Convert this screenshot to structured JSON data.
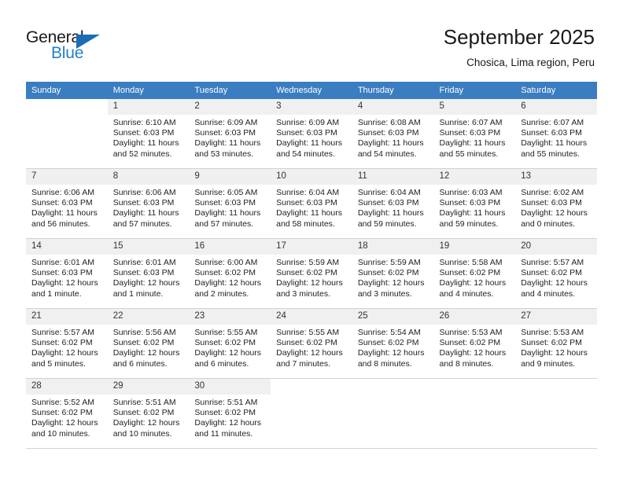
{
  "brand": {
    "name_part1": "General",
    "name_part2": "Blue",
    "triangle_color": "#1b6cb5",
    "blue_color": "#2580c8"
  },
  "header": {
    "title": "September 2025",
    "subtitle": "Chosica, Lima region, Peru"
  },
  "theme": {
    "header_row_bg": "#3a7dc0",
    "daynum_bg": "#f0f0f0",
    "grid_line": "#d2d2d2"
  },
  "weekdays": [
    "Sunday",
    "Monday",
    "Tuesday",
    "Wednesday",
    "Thursday",
    "Friday",
    "Saturday"
  ],
  "weeks": [
    [
      {
        "day": "",
        "blank": true,
        "sunrise": "",
        "sunset": "",
        "daylight1": "",
        "daylight2": ""
      },
      {
        "day": "1",
        "sunrise": "Sunrise: 6:10 AM",
        "sunset": "Sunset: 6:03 PM",
        "daylight1": "Daylight: 11 hours",
        "daylight2": "and 52 minutes."
      },
      {
        "day": "2",
        "sunrise": "Sunrise: 6:09 AM",
        "sunset": "Sunset: 6:03 PM",
        "daylight1": "Daylight: 11 hours",
        "daylight2": "and 53 minutes."
      },
      {
        "day": "3",
        "sunrise": "Sunrise: 6:09 AM",
        "sunset": "Sunset: 6:03 PM",
        "daylight1": "Daylight: 11 hours",
        "daylight2": "and 54 minutes."
      },
      {
        "day": "4",
        "sunrise": "Sunrise: 6:08 AM",
        "sunset": "Sunset: 6:03 PM",
        "daylight1": "Daylight: 11 hours",
        "daylight2": "and 54 minutes."
      },
      {
        "day": "5",
        "sunrise": "Sunrise: 6:07 AM",
        "sunset": "Sunset: 6:03 PM",
        "daylight1": "Daylight: 11 hours",
        "daylight2": "and 55 minutes."
      },
      {
        "day": "6",
        "sunrise": "Sunrise: 6:07 AM",
        "sunset": "Sunset: 6:03 PM",
        "daylight1": "Daylight: 11 hours",
        "daylight2": "and 55 minutes."
      }
    ],
    [
      {
        "day": "7",
        "sunrise": "Sunrise: 6:06 AM",
        "sunset": "Sunset: 6:03 PM",
        "daylight1": "Daylight: 11 hours",
        "daylight2": "and 56 minutes."
      },
      {
        "day": "8",
        "sunrise": "Sunrise: 6:06 AM",
        "sunset": "Sunset: 6:03 PM",
        "daylight1": "Daylight: 11 hours",
        "daylight2": "and 57 minutes."
      },
      {
        "day": "9",
        "sunrise": "Sunrise: 6:05 AM",
        "sunset": "Sunset: 6:03 PM",
        "daylight1": "Daylight: 11 hours",
        "daylight2": "and 57 minutes."
      },
      {
        "day": "10",
        "sunrise": "Sunrise: 6:04 AM",
        "sunset": "Sunset: 6:03 PM",
        "daylight1": "Daylight: 11 hours",
        "daylight2": "and 58 minutes."
      },
      {
        "day": "11",
        "sunrise": "Sunrise: 6:04 AM",
        "sunset": "Sunset: 6:03 PM",
        "daylight1": "Daylight: 11 hours",
        "daylight2": "and 59 minutes."
      },
      {
        "day": "12",
        "sunrise": "Sunrise: 6:03 AM",
        "sunset": "Sunset: 6:03 PM",
        "daylight1": "Daylight: 11 hours",
        "daylight2": "and 59 minutes."
      },
      {
        "day": "13",
        "sunrise": "Sunrise: 6:02 AM",
        "sunset": "Sunset: 6:03 PM",
        "daylight1": "Daylight: 12 hours",
        "daylight2": "and 0 minutes."
      }
    ],
    [
      {
        "day": "14",
        "sunrise": "Sunrise: 6:01 AM",
        "sunset": "Sunset: 6:03 PM",
        "daylight1": "Daylight: 12 hours",
        "daylight2": "and 1 minute."
      },
      {
        "day": "15",
        "sunrise": "Sunrise: 6:01 AM",
        "sunset": "Sunset: 6:03 PM",
        "daylight1": "Daylight: 12 hours",
        "daylight2": "and 1 minute."
      },
      {
        "day": "16",
        "sunrise": "Sunrise: 6:00 AM",
        "sunset": "Sunset: 6:02 PM",
        "daylight1": "Daylight: 12 hours",
        "daylight2": "and 2 minutes."
      },
      {
        "day": "17",
        "sunrise": "Sunrise: 5:59 AM",
        "sunset": "Sunset: 6:02 PM",
        "daylight1": "Daylight: 12 hours",
        "daylight2": "and 3 minutes."
      },
      {
        "day": "18",
        "sunrise": "Sunrise: 5:59 AM",
        "sunset": "Sunset: 6:02 PM",
        "daylight1": "Daylight: 12 hours",
        "daylight2": "and 3 minutes."
      },
      {
        "day": "19",
        "sunrise": "Sunrise: 5:58 AM",
        "sunset": "Sunset: 6:02 PM",
        "daylight1": "Daylight: 12 hours",
        "daylight2": "and 4 minutes."
      },
      {
        "day": "20",
        "sunrise": "Sunrise: 5:57 AM",
        "sunset": "Sunset: 6:02 PM",
        "daylight1": "Daylight: 12 hours",
        "daylight2": "and 4 minutes."
      }
    ],
    [
      {
        "day": "21",
        "sunrise": "Sunrise: 5:57 AM",
        "sunset": "Sunset: 6:02 PM",
        "daylight1": "Daylight: 12 hours",
        "daylight2": "and 5 minutes."
      },
      {
        "day": "22",
        "sunrise": "Sunrise: 5:56 AM",
        "sunset": "Sunset: 6:02 PM",
        "daylight1": "Daylight: 12 hours",
        "daylight2": "and 6 minutes."
      },
      {
        "day": "23",
        "sunrise": "Sunrise: 5:55 AM",
        "sunset": "Sunset: 6:02 PM",
        "daylight1": "Daylight: 12 hours",
        "daylight2": "and 6 minutes."
      },
      {
        "day": "24",
        "sunrise": "Sunrise: 5:55 AM",
        "sunset": "Sunset: 6:02 PM",
        "daylight1": "Daylight: 12 hours",
        "daylight2": "and 7 minutes."
      },
      {
        "day": "25",
        "sunrise": "Sunrise: 5:54 AM",
        "sunset": "Sunset: 6:02 PM",
        "daylight1": "Daylight: 12 hours",
        "daylight2": "and 8 minutes."
      },
      {
        "day": "26",
        "sunrise": "Sunrise: 5:53 AM",
        "sunset": "Sunset: 6:02 PM",
        "daylight1": "Daylight: 12 hours",
        "daylight2": "and 8 minutes."
      },
      {
        "day": "27",
        "sunrise": "Sunrise: 5:53 AM",
        "sunset": "Sunset: 6:02 PM",
        "daylight1": "Daylight: 12 hours",
        "daylight2": "and 9 minutes."
      }
    ],
    [
      {
        "day": "28",
        "sunrise": "Sunrise: 5:52 AM",
        "sunset": "Sunset: 6:02 PM",
        "daylight1": "Daylight: 12 hours",
        "daylight2": "and 10 minutes."
      },
      {
        "day": "29",
        "sunrise": "Sunrise: 5:51 AM",
        "sunset": "Sunset: 6:02 PM",
        "daylight1": "Daylight: 12 hours",
        "daylight2": "and 10 minutes."
      },
      {
        "day": "30",
        "sunrise": "Sunrise: 5:51 AM",
        "sunset": "Sunset: 6:02 PM",
        "daylight1": "Daylight: 12 hours",
        "daylight2": "and 11 minutes."
      },
      {
        "day": "",
        "blank": true,
        "sunrise": "",
        "sunset": "",
        "daylight1": "",
        "daylight2": ""
      },
      {
        "day": "",
        "blank": true,
        "sunrise": "",
        "sunset": "",
        "daylight1": "",
        "daylight2": ""
      },
      {
        "day": "",
        "blank": true,
        "sunrise": "",
        "sunset": "",
        "daylight1": "",
        "daylight2": ""
      },
      {
        "day": "",
        "blank": true,
        "sunrise": "",
        "sunset": "",
        "daylight1": "",
        "daylight2": ""
      }
    ]
  ]
}
